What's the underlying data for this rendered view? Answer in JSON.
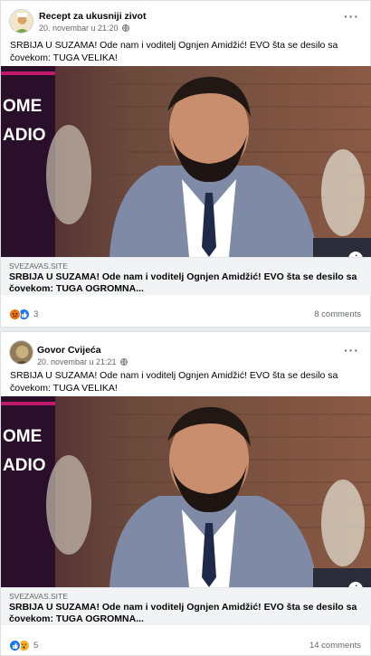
{
  "posts": [
    {
      "author": "Recept za ukusniji zivot",
      "time": "20. novembar u 21:20",
      "privacy_icon": "globe-icon",
      "caption": "SRBIJA U SUZAMA! Ode nam i voditelj Ognjen Amidžić! EVO šta se desilo sa čovekom: TUGA VELIKA!",
      "image_sign_lines": [
        "OME",
        "ADIO"
      ],
      "link_domain": "SVEZAVAS.SITE",
      "link_title": "SRBIJA U SUZAMA! Ode nam i voditelj Ognjen Amidžić! EVO šta se desilo sa čovekom: TUGA OGROMNA...",
      "reactions": [
        "angry-reaction-icon",
        "like-reaction-icon"
      ],
      "reaction_count": "3",
      "comments": "8 comments"
    },
    {
      "author": "Govor Cvijeća",
      "time": "20. novembar u 21:21",
      "privacy_icon": "globe-icon",
      "caption": "SRBIJA U SUZAMA! Ode nam i voditelj Ognjen Amidžić! EVO šta se desilo sa čovekom: TUGA VELIKA!",
      "image_sign_lines": [
        "OME",
        "ADIO"
      ],
      "link_domain": "SVEZAVAS.SITE",
      "link_title": "SRBIJA U SUZAMA! Ode nam i voditelj Ognjen Amidžić! EVO šta se desilo sa čovekom: TUGA OGROMNA...",
      "reactions": [
        "like-reaction-icon",
        "wow-reaction-icon"
      ],
      "reaction_count": "5",
      "comments": "14 comments"
    }
  ],
  "colors": {
    "like": "#1877f2",
    "angry": "#e9710f",
    "wow": "#f7b125",
    "muted_text": "#65676b"
  }
}
